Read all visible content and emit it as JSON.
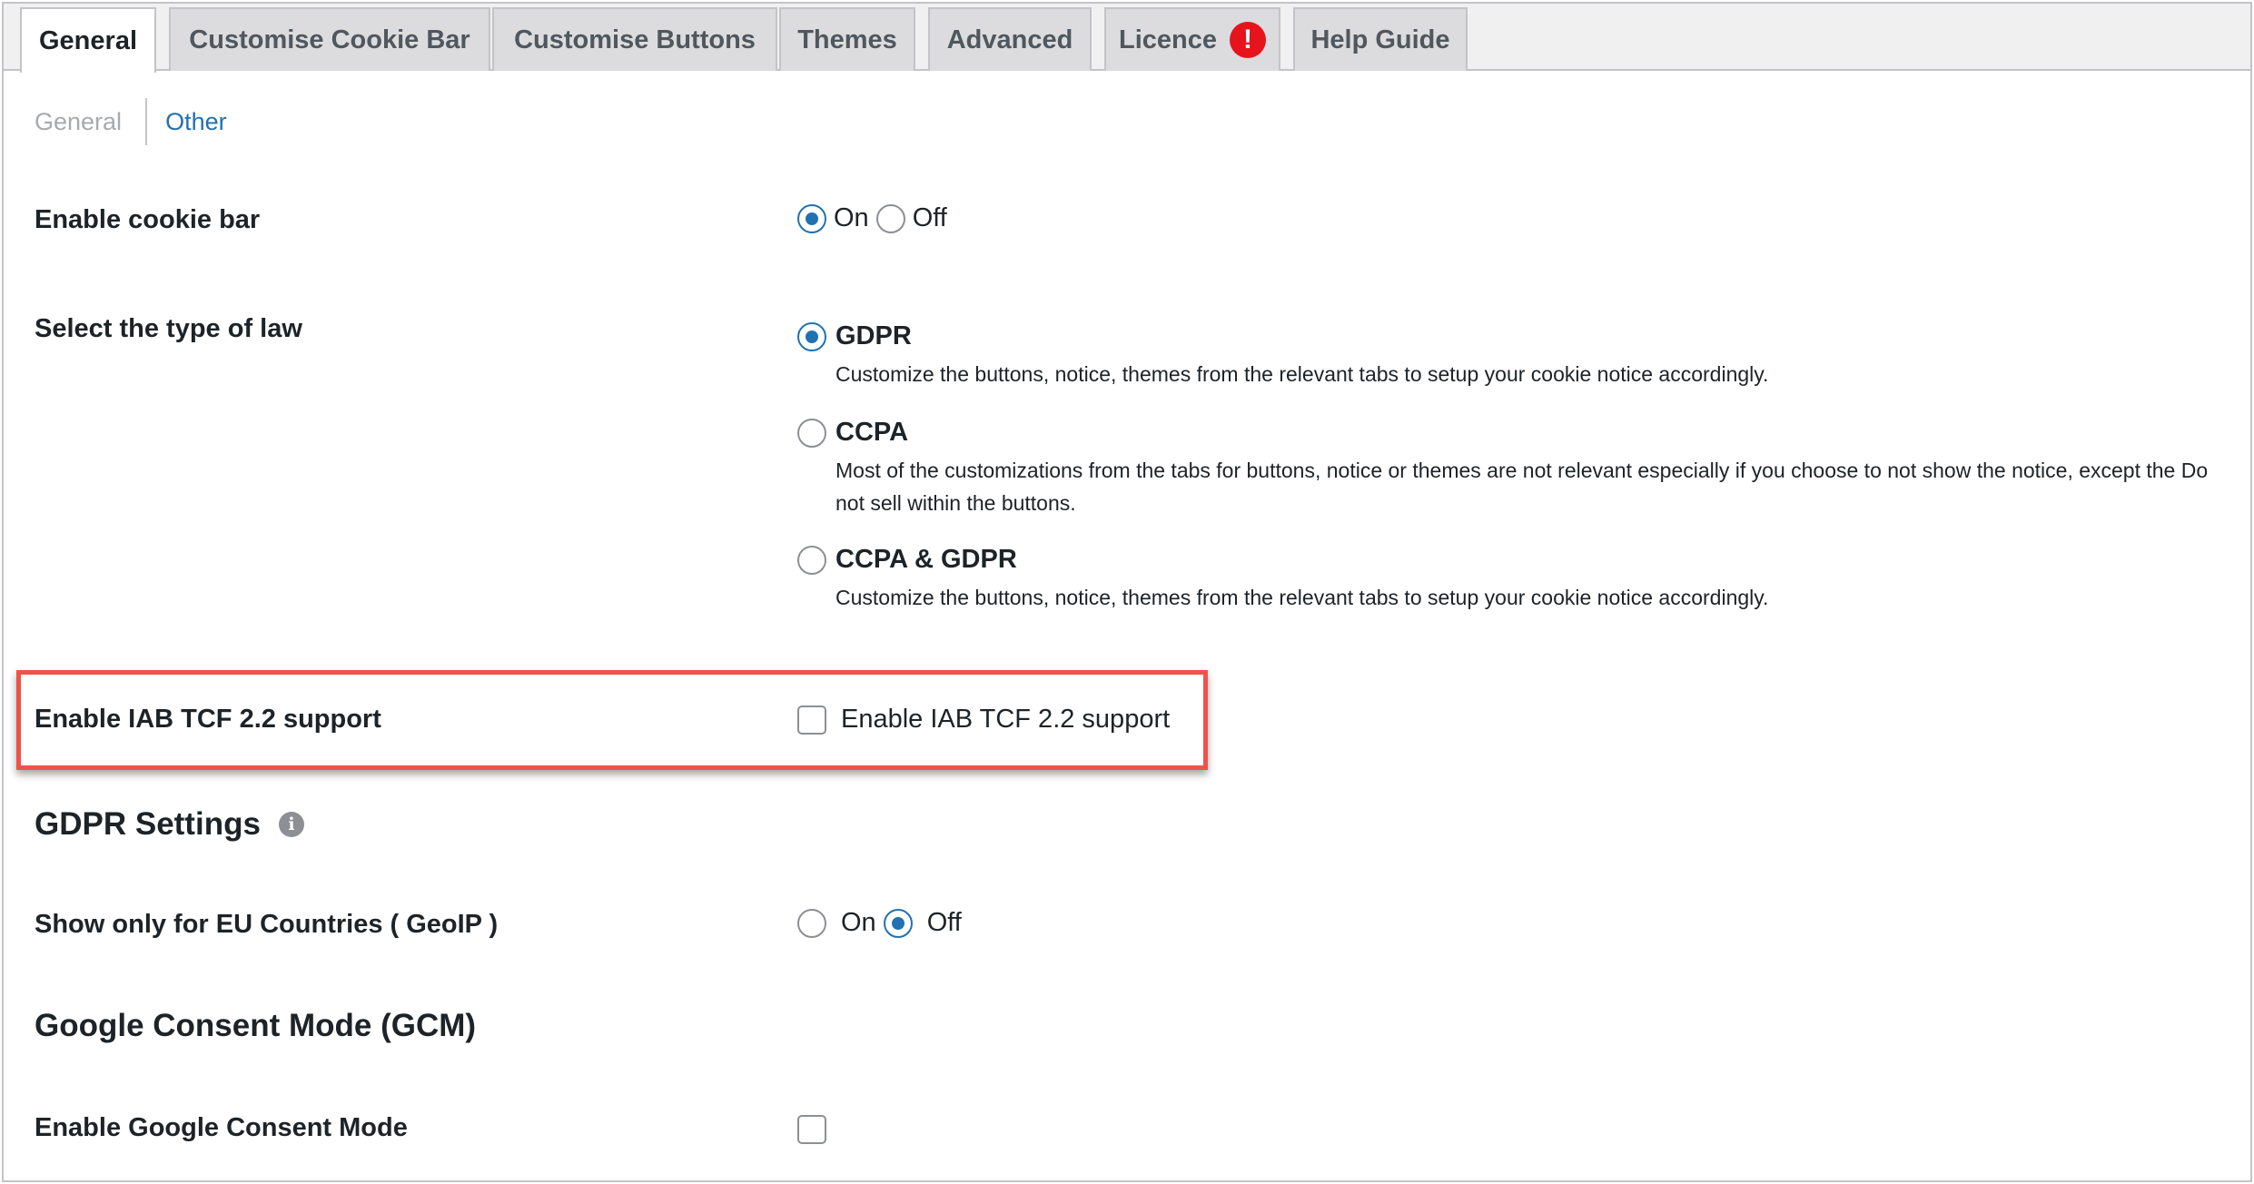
{
  "tabs": [
    {
      "label": "General",
      "active": true
    },
    {
      "label": "Customise Cookie Bar"
    },
    {
      "label": "Customise Buttons"
    },
    {
      "label": "Themes"
    },
    {
      "label": "Advanced"
    },
    {
      "label": "Licence",
      "badge_icon": "exclamation-alert-icon",
      "badge_text": "!"
    },
    {
      "label": "Help Guide"
    }
  ],
  "subnav": {
    "general": "General",
    "other": "Other"
  },
  "enable_cookie_bar": {
    "label": "Enable cookie bar",
    "on": "On",
    "off": "Off",
    "selected": "On"
  },
  "law_type": {
    "label": "Select the type of law",
    "selected": "GDPR",
    "options": [
      {
        "title": "GDPR",
        "desc": "Customize the buttons, notice, themes from the relevant tabs to setup your cookie notice accordingly."
      },
      {
        "title": "CCPA",
        "desc": "Most of the customizations from the tabs for buttons, notice or themes are not relevant especially if you choose to not show the notice, except the Do not sell within the buttons."
      },
      {
        "title": "CCPA & GDPR",
        "desc": "Customize the buttons, notice, themes from the relevant tabs to setup your cookie notice accordingly."
      }
    ]
  },
  "iab_tcf": {
    "label": "Enable IAB TCF 2.2 support",
    "checkbox_label": "Enable IAB TCF 2.2 support",
    "checked": false,
    "highlight_color": "#f0524a"
  },
  "gdpr_settings": {
    "heading": "GDPR Settings",
    "info_icon": "info-icon",
    "info_glyph": "i"
  },
  "eu_only": {
    "label": "Show only for EU Countries ( GeoIP )",
    "on": "On",
    "off": "Off",
    "selected": "Off"
  },
  "gcm": {
    "heading": "Google Consent Mode (GCM)",
    "label": "Enable Google Consent Mode",
    "checked": false
  },
  "colors": {
    "accent": "#2271b1",
    "alert": "#e6141c"
  }
}
